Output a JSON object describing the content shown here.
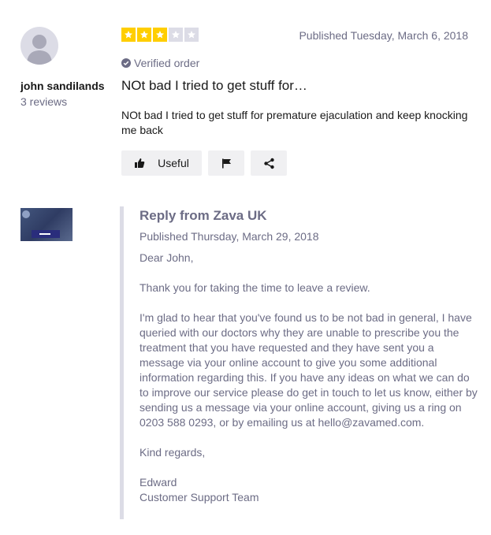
{
  "reviewer": {
    "name": "john sandilands",
    "review_count": "3 reviews"
  },
  "review": {
    "rating": 3,
    "max_rating": 5,
    "published": "Published Tuesday, March 6, 2018",
    "verified": "Verified order",
    "title": "NOt bad I tried to get stuff for…",
    "body": "NOt bad I tried to get stuff for premature ejaculation and keep knocking me back"
  },
  "actions": {
    "useful_label": "Useful",
    "useful_icon": "thumbs-up-icon",
    "flag_icon": "flag-icon",
    "share_icon": "share-icon"
  },
  "reply": {
    "title": "Reply from Zava UK",
    "published": "Published Thursday, March 29, 2018",
    "greeting": "Dear John,",
    "paragraph1": "Thank you for taking the time to leave a review.",
    "paragraph2": "I'm glad to hear that you've found us to be not bad in general, I have queried with our doctors why they are unable to prescribe you the treatment that you have requested and they have sent you a message via your online account to give you some additional information regarding this. If you have any ideas on what we can do to improve our service please do get in touch to let us know, either by sending us a message via your online account, giving us a ring on 0203 588 0293, or by emailing us at hello@zavamed.com.",
    "signoff": "Kind regards,",
    "signature_name": "Edward",
    "signature_team": "Customer Support Team"
  },
  "colors": {
    "star_filled": "#ffce00",
    "star_empty": "#dcdce6",
    "muted_text": "#6c6c85",
    "button_bg": "#f0f0f2"
  }
}
